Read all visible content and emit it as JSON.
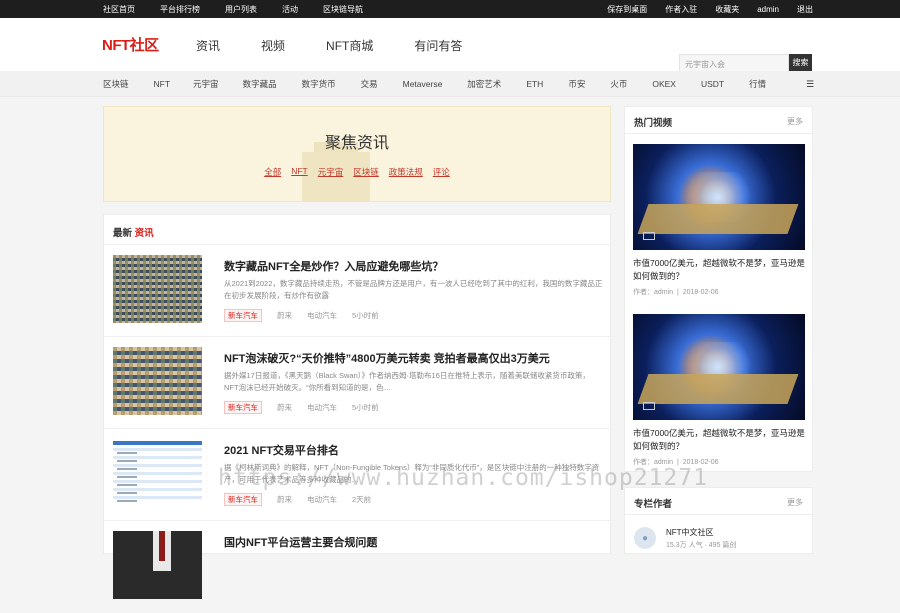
{
  "topbar": {
    "left": [
      "社区首页",
      "平台排行榜",
      "用户列表",
      "活动",
      "区块链导航"
    ],
    "right": [
      "保存到桌面",
      "作者入驻",
      "收藏夹",
      "admin",
      "退出"
    ]
  },
  "header": {
    "logo": "NFT社区",
    "nav": [
      "资讯",
      "视频",
      "NFT商城",
      "有问有答"
    ],
    "search_placeholder": "元宇宙入会",
    "search_button": "搜索"
  },
  "categories": [
    "区块链",
    "NFT",
    "元宇宙",
    "数字藏品",
    "数字货币",
    "交易",
    "Metaverse",
    "加密艺术",
    "ETH",
    "币安",
    "火币",
    "OKEX",
    "USDT",
    "行情"
  ],
  "menu_icon": "menu-icon",
  "banner": {
    "title": "聚焦资讯",
    "filters": [
      "全部",
      "NFT",
      "元宇宙",
      "区块链",
      "政策法规",
      "评论"
    ]
  },
  "latest": {
    "heading_a": "最新",
    "heading_b": "资讯",
    "articles": [
      {
        "title": "数字藏品NFT全是炒作？入局应避免哪些坑？",
        "desc": "从2021到2022，数字藏品持续走热，不管是品牌方还是用户，有一波人已经吃到了其中的红利，我国的数字藏品正在初步发展阶段，有炒作有欲露",
        "tag": "新车汽车",
        "meta": [
          "蔚来",
          "电动汽车",
          "5小时前"
        ]
      },
      {
        "title": "NFT泡沫破灭?“天价推特”4800万美元转卖 竞拍者最高仅出3万美元",
        "desc": "据外媒17日报道，《黑天鹅（Black Swan）》作者纳西姆·塔勒布16日在推特上表示，随着美联储收紧货币政策，NFT泡沫已经开始破灭。“你所看到知道的是，色…",
        "tag": "新车汽车",
        "meta": [
          "蔚来",
          "电动汽车",
          "5小时前"
        ]
      },
      {
        "title": "2021 NFT交易平台排名",
        "desc": "据《柯林斯词典》的解释，NFT（Non-Fungible Tokens）释为“非同质化代币”，是区块链中注册的一种独特数字资产，可用于代表艺术品等多种收藏品的…",
        "tag": "新车汽车",
        "meta": [
          "蔚来",
          "电动汽车",
          "2天前"
        ]
      },
      {
        "title": "国内NFT平台运营主要合规问题"
      }
    ]
  },
  "hot_videos": {
    "title": "热门视频",
    "more": "更多",
    "items": [
      {
        "title": "市值7000亿美元，超越微软不是梦，亚马逊是如何做到的？",
        "author": "作者：admin",
        "date": "2018-02-06"
      },
      {
        "title": "市值7000亿美元，超越微软不是梦，亚马逊是如何做到的？",
        "author": "作者：admin",
        "date": "2018-02-06"
      }
    ]
  },
  "columnists": {
    "title": "专栏作者",
    "more": "更多",
    "author": {
      "name": "NFT中文社区",
      "stats": "15.3万 人气 · 495 篇创"
    }
  },
  "watermark": "https://www.huzhan.com/ishop21271"
}
